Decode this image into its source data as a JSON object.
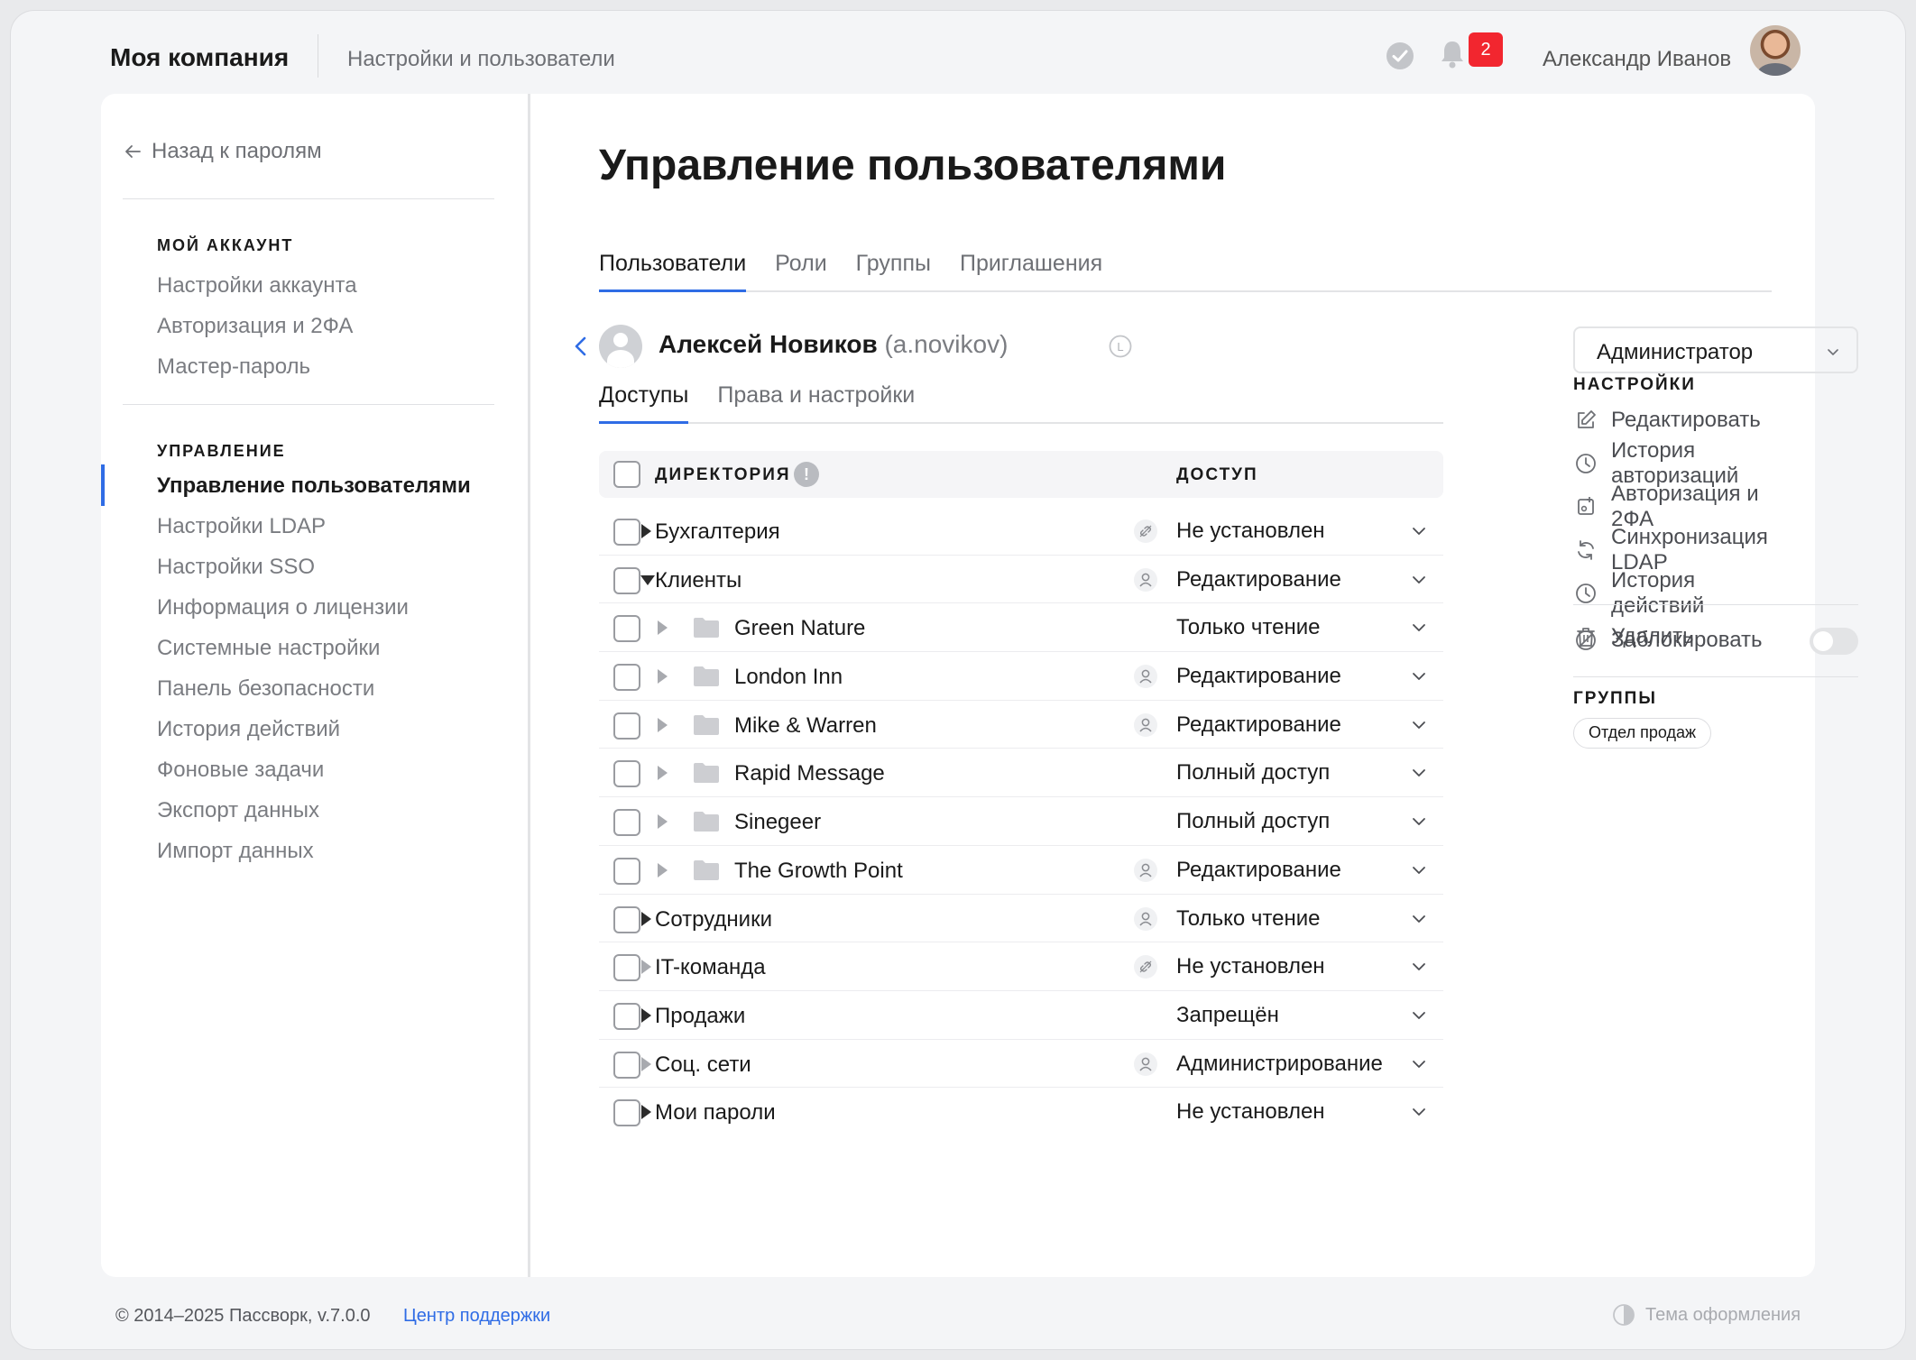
{
  "header": {
    "brand": "Моя компания",
    "section": "Настройки и пользователи",
    "notifications_count": "2",
    "user_name": "Александр Иванов",
    "icons": [
      "check-circle-icon",
      "bell-icon",
      "avatar"
    ]
  },
  "sidebar": {
    "back_label": "Назад к паролям",
    "account_heading": "МОЙ АККАУНТ",
    "account_items": [
      "Настройки аккаунта",
      "Авторизация и 2ФА",
      "Мастер-пароль"
    ],
    "admin_heading": "УПРАВЛЕНИЕ",
    "admin_items": [
      "Управление пользователями",
      "Настройки LDAP",
      "Настройки SSO",
      "Информация о лицензии",
      "Системные настройки",
      "Панель безопасности",
      "История действий",
      "Фоновые задачи",
      "Экспорт данных",
      "Импорт данных"
    ],
    "active_item": "Управление пользователями"
  },
  "main": {
    "title": "Управление пользователями",
    "tabs": [
      "Пользователи",
      "Роли",
      "Группы",
      "Приглашения"
    ],
    "active_tab": "Пользователи",
    "user": {
      "name": "Алексей Новиков",
      "login": "(a.novikov)",
      "badge_letter": "L"
    },
    "subtabs": [
      "Доступы",
      "Права и настройки"
    ],
    "active_subtab": "Доступы",
    "table": {
      "col_directory": "ДИРЕКТОРИЯ",
      "info_symbol": "!",
      "col_access": "ДОСТУП",
      "rows": [
        {
          "name": "Бухгалтерия",
          "level": 0,
          "arrow": "right",
          "arrow_style": "dark",
          "folder": false,
          "icon": "unlink-icon",
          "access": "Не установлен"
        },
        {
          "name": "Клиенты",
          "level": 0,
          "arrow": "down",
          "arrow_style": "dark",
          "folder": false,
          "icon": "user-icon",
          "access": "Редактирование"
        },
        {
          "name": "Green Nature",
          "level": 1,
          "arrow": "right",
          "arrow_style": "light",
          "folder": true,
          "icon": "",
          "access": "Только чтение"
        },
        {
          "name": "London Inn",
          "level": 1,
          "arrow": "right",
          "arrow_style": "light",
          "folder": true,
          "icon": "user-icon",
          "access": "Редактирование"
        },
        {
          "name": "Mike & Warren",
          "level": 1,
          "arrow": "right",
          "arrow_style": "light",
          "folder": true,
          "icon": "user-icon",
          "access": "Редактирование"
        },
        {
          "name": "Rapid Message",
          "level": 1,
          "arrow": "right",
          "arrow_style": "light",
          "folder": true,
          "icon": "",
          "access": "Полный доступ"
        },
        {
          "name": "Sinegeer",
          "level": 1,
          "arrow": "right",
          "arrow_style": "light",
          "folder": true,
          "icon": "",
          "access": "Полный доступ"
        },
        {
          "name": "The Growth Point",
          "level": 1,
          "arrow": "right",
          "arrow_style": "light",
          "folder": true,
          "icon": "user-icon",
          "access": "Редактирование"
        },
        {
          "name": "Сотрудники",
          "level": 0,
          "arrow": "right",
          "arrow_style": "dark",
          "folder": false,
          "icon": "user-icon",
          "access": "Только чтение"
        },
        {
          "name": "IT-команда",
          "level": 0,
          "arrow": "right",
          "arrow_style": "light",
          "folder": false,
          "icon": "unlink-icon",
          "access": "Не установлен"
        },
        {
          "name": "Продажи",
          "level": 0,
          "arrow": "right",
          "arrow_style": "dark",
          "folder": false,
          "icon": "",
          "access": "Запрещён"
        },
        {
          "name": "Соц. сети",
          "level": 0,
          "arrow": "right",
          "arrow_style": "light",
          "folder": false,
          "icon": "user-icon",
          "access": "Администрирование"
        },
        {
          "name": "Мои пароли",
          "level": 0,
          "arrow": "right",
          "arrow_style": "dark",
          "folder": false,
          "icon": "",
          "access": "Не установлен"
        }
      ]
    }
  },
  "panel": {
    "role": "Администратор",
    "settings_heading": "НАСТРОЙКИ",
    "actions": [
      {
        "label": "Редактировать",
        "icon": "edit-icon"
      },
      {
        "label": "История авторизаций",
        "icon": "clock-icon"
      },
      {
        "label": "Авторизация и 2ФА",
        "icon": "two-factor-icon"
      },
      {
        "label": "Синхронизация LDAP",
        "icon": "sync-icon"
      },
      {
        "label": "История действий",
        "icon": "clock-icon"
      },
      {
        "label": "Удалить",
        "icon": "trash-icon"
      }
    ],
    "block_label": "Заблокировать",
    "block_enabled": false,
    "groups_heading": "ГРУППЫ",
    "groups": [
      "Отдел продаж"
    ]
  },
  "footer": {
    "copyright": "© 2014–2025 Пассворк, v.7.0.0",
    "support_link": "Центр поддержки",
    "theme_label": "Тема оформления"
  },
  "colors": {
    "accent": "#2f6ce5",
    "badge": "#f2262f",
    "muted_text": "#7a7c81"
  }
}
